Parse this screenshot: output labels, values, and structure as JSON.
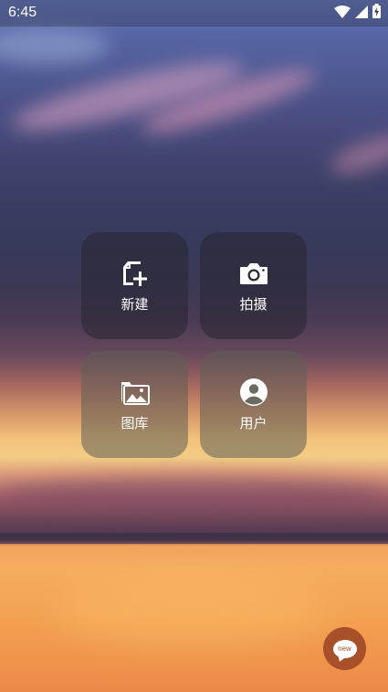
{
  "status_bar": {
    "time": "6:45",
    "icons": [
      "wifi-icon",
      "cell-signal-icon",
      "battery-charging-icon"
    ]
  },
  "tiles": [
    {
      "label": "新建",
      "icon": "new-document-icon"
    },
    {
      "label": "拍摄",
      "icon": "camera-icon"
    },
    {
      "label": "图库",
      "icon": "gallery-icon"
    },
    {
      "label": "用户",
      "icon": "user-icon"
    }
  ],
  "fab": {
    "label": "new",
    "icon": "chat-bubble-icon",
    "color": "#a7502a"
  }
}
